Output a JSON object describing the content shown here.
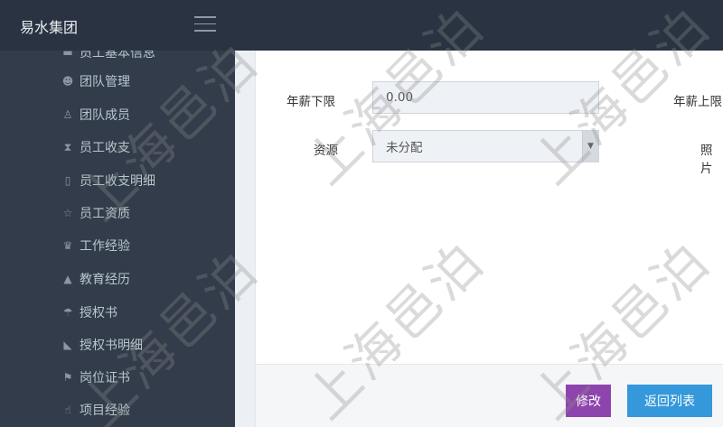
{
  "header": {
    "brand": "易水集团"
  },
  "sidebar": {
    "items": [
      {
        "label": "员工基本信息",
        "icon": "id-card-icon",
        "glyph": "▬"
      },
      {
        "label": "团队管理",
        "icon": "users-icon",
        "glyph": "☻"
      },
      {
        "label": "团队成员",
        "icon": "user-icon",
        "glyph": "♙"
      },
      {
        "label": "员工收支",
        "icon": "hourglass-icon",
        "glyph": "⧗"
      },
      {
        "label": "员工收支明细",
        "icon": "map-icon",
        "glyph": "▯"
      },
      {
        "label": "员工资质",
        "icon": "star-icon",
        "glyph": "☆"
      },
      {
        "label": "工作经验",
        "icon": "trophy-icon",
        "glyph": "♛"
      },
      {
        "label": "教育经历",
        "icon": "graduation-cap-icon",
        "glyph": "▲"
      },
      {
        "label": "授权书",
        "icon": "umbrella-icon",
        "glyph": "☂"
      },
      {
        "label": "授权书明细",
        "icon": "gavel-icon",
        "glyph": "◣"
      },
      {
        "label": "岗位证书",
        "icon": "flag-icon",
        "glyph": "⚑"
      },
      {
        "label": "项目经验",
        "icon": "hand-pointer-icon",
        "glyph": "☝"
      }
    ]
  },
  "form": {
    "salary_min_label": "年薪下限",
    "salary_min_value": "0.00",
    "salary_max_label": "年薪上限",
    "resource_label": "资源",
    "resource_value": "未分配",
    "photo_label": "照片"
  },
  "footer": {
    "edit_label": "修改",
    "back_label": "返回列表"
  },
  "watermark": {
    "text": "上海邑泊"
  }
}
